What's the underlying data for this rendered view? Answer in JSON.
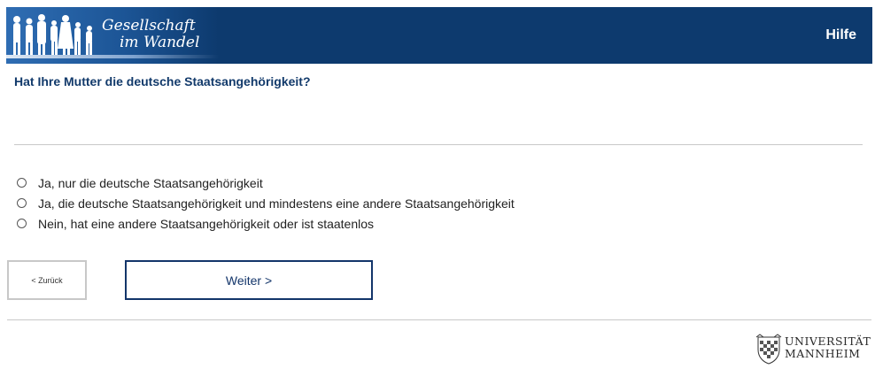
{
  "header": {
    "logo_line1": "Gesellschaft",
    "logo_line2": "im Wandel",
    "help_label": "Hilfe"
  },
  "question": {
    "text": "Hat Ihre Mutter die deutsche Staatsangehörigkeit?"
  },
  "options": [
    {
      "label": "Ja, nur die deutsche Staatsangehörigkeit"
    },
    {
      "label": "Ja, die deutsche Staatsangehörigkeit und mindestens eine andere Staatsangehörigkeit"
    },
    {
      "label": "Nein, hat eine andere Staatsangehörigkeit oder ist staatenlos"
    }
  ],
  "nav": {
    "back_label": "< Zurück",
    "next_label": "Weiter >"
  },
  "footer": {
    "uni_line1": "UNIVERSITÄT",
    "uni_line2": "MANNHEIM"
  },
  "colors": {
    "header_bg": "#0d3a6e",
    "accent": "#13356a"
  }
}
